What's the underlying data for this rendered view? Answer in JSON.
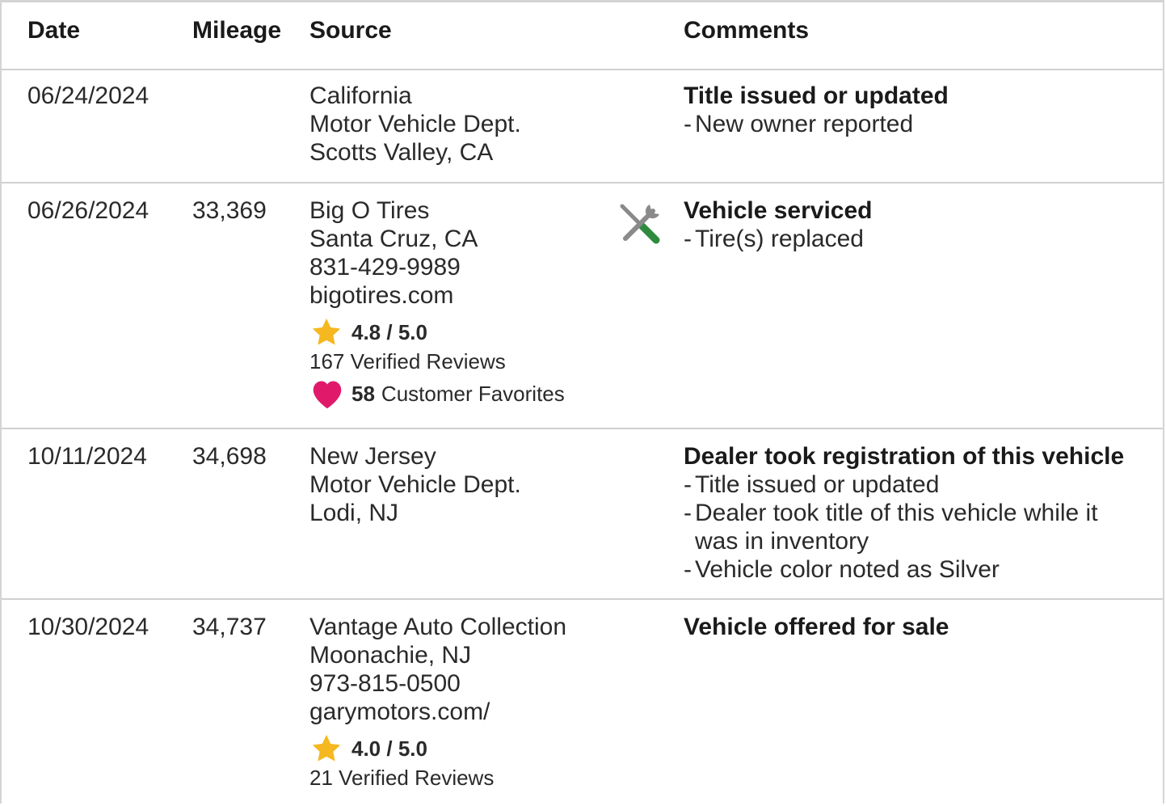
{
  "headers": {
    "date": "Date",
    "mileage": "Mileage",
    "source": "Source",
    "comments": "Comments"
  },
  "colors": {
    "star": "#F5B820",
    "heart": "#E0196B",
    "wrench_handle": "#2E8B3E",
    "tool_gray": "#8A8A8A"
  },
  "rows": [
    {
      "date": "06/24/2024",
      "mileage": "",
      "source_lines": [
        "California",
        "Motor Vehicle Dept.",
        "Scotts Valley, CA"
      ],
      "comment_title": "Title issued or updated",
      "comment_bullets": [
        "New owner reported"
      ]
    },
    {
      "date": "06/26/2024",
      "mileage": "33,369",
      "source_lines": [
        "Big O Tires",
        "Santa Cruz, CA",
        "831-429-9989",
        "bigotires.com"
      ],
      "rating": "4.8 / 5.0",
      "reviews": "167 Verified Reviews",
      "favorites_count": "58",
      "favorites_label": "Customer Favorites",
      "icon": "service-tools-icon",
      "comment_title": "Vehicle serviced",
      "comment_bullets": [
        "Tire(s) replaced"
      ]
    },
    {
      "date": "10/11/2024",
      "mileage": "34,698",
      "source_lines": [
        "New Jersey",
        "Motor Vehicle Dept.",
        "Lodi, NJ"
      ],
      "comment_title": "Dealer took registration of this vehicle",
      "comment_bullets": [
        "Title issued or updated",
        "Dealer took title of this vehicle while it was in inventory",
        "Vehicle color noted as Silver"
      ]
    },
    {
      "date": "10/30/2024",
      "mileage": "34,737",
      "source_lines": [
        "Vantage Auto Collection",
        "Moonachie, NJ",
        "973-815-0500",
        "garymotors.com/"
      ],
      "rating": "4.0 / 5.0",
      "reviews": "21 Verified Reviews",
      "comment_title": "Vehicle offered for sale",
      "comment_bullets": []
    }
  ]
}
